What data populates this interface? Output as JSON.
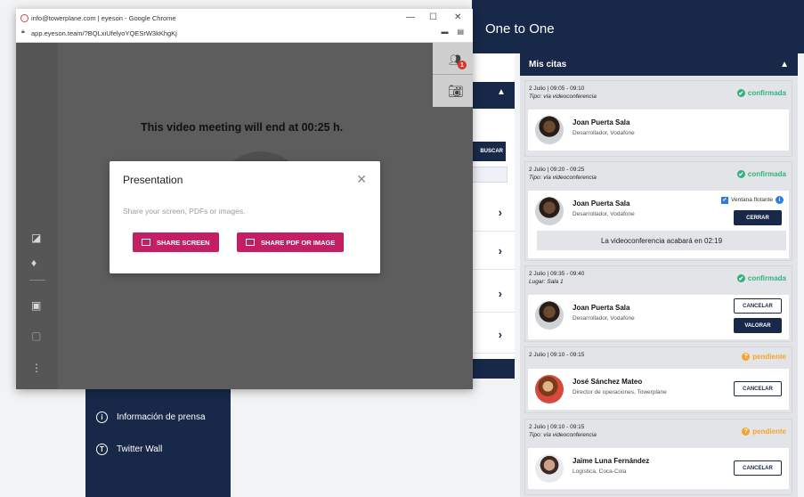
{
  "app": {
    "topbar_title": "One to One",
    "nav": [
      {
        "label": "Información de prensa",
        "icon": "info-icon",
        "glyph": "i"
      },
      {
        "label": "Twitter Wall",
        "icon": "twitter-icon",
        "glyph": "T"
      }
    ],
    "mid": {
      "search_button": "BUSCAR",
      "chevron": "▲",
      "row_arrow": "›"
    }
  },
  "citas": {
    "title": "Mis citas",
    "chevron": "▲",
    "cards": [
      {
        "date": "2 Julio | 09:05 - 09:10",
        "type": "Tipo: vía videoconferencia",
        "status": "confirmada",
        "status_icon": "✔",
        "name": "Joan Puerta Sala",
        "role": "Desarrollador, Vodafone"
      },
      {
        "date": "2 Julio | 09:20 - 09:25",
        "type": "Tipo: vía videoconferencia",
        "status": "confirmada",
        "status_icon": "✔",
        "name": "Joan Puerta Sala",
        "role": "Desarrollador, Vodafone",
        "floating_label": "Ventana flotante",
        "close_button": "CERRAR",
        "ends_text": "La videoconferencia acabará en 02:19"
      },
      {
        "date": "2 Julio | 09:35 - 09:40",
        "type": "Lugar: Sala 1",
        "status": "confirmada",
        "status_icon": "✔",
        "name": "Joan Puerta Sala",
        "role": "Desarrollador, Vodafone",
        "cancel_button": "CANCELAR",
        "rate_button": "VALORAR"
      },
      {
        "date": "2 Julio | 09:10 - 09:15",
        "type": "",
        "status": "pendiente",
        "status_icon": "?",
        "name": "José Sánchez Mateo",
        "role": "Director de operaciones, Towerplane",
        "cancel_button": "CANCELAR"
      },
      {
        "date": "2 Julio | 09:10 - 09:15",
        "type": "Tipo: vía videoconferencia",
        "status": "pendiente",
        "status_icon": "?",
        "name": "Jaime Luna Fernández",
        "role": "Logística, Coca-Cola",
        "cancel_button": "CANCELAR"
      }
    ]
  },
  "popup": {
    "window_title": "info@towerplane.com | eyeson - Google Chrome",
    "url": "app.eyeson.team/?BQLxiUfelyoYQESrW3kKhgKj",
    "minimize": "—",
    "maximize": "☐",
    "close": "✕",
    "meeting_message": "This video meeting will end at 00:25 h.",
    "participants_badge": "1",
    "modal": {
      "title": "Presentation",
      "close": "✕",
      "description": "Share your screen, PDFs or images.",
      "share_screen": "SHARE SCREEN",
      "share_pdf": "SHARE PDF OR IMAGE"
    }
  },
  "colors": {
    "navy": "#172848",
    "confirm": "#2eb37d",
    "pending": "#f4a42d",
    "magenta": "#c41e64"
  }
}
